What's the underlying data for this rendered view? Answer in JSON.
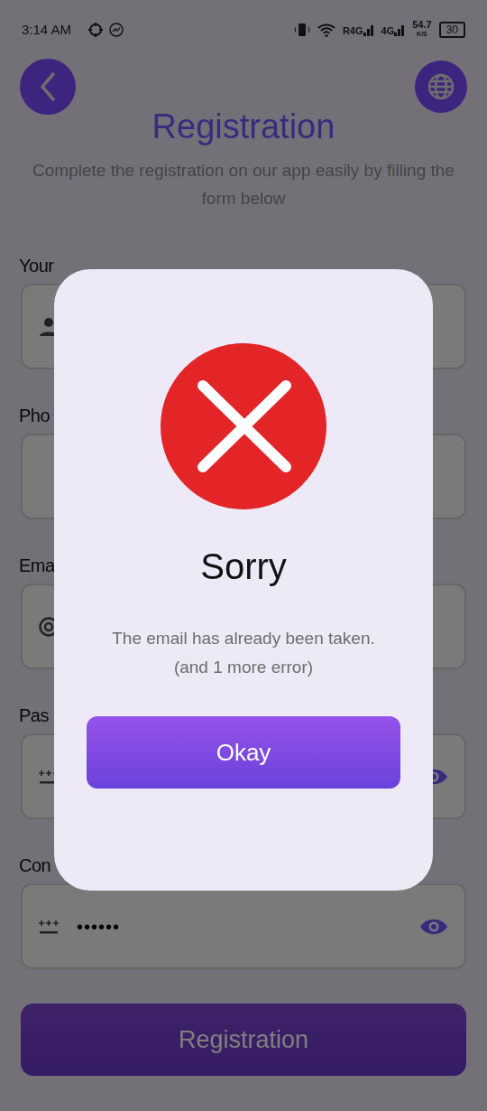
{
  "status_bar": {
    "time": "3:14 AM",
    "network_1": "R4G",
    "network_2": "4G",
    "speed": "54.7",
    "speed_unit": "K/S",
    "battery": "30"
  },
  "header": {
    "title": "Registration",
    "subtitle": "Complete the registration on our app easily by filling the form below"
  },
  "fields": [
    {
      "label": "Your",
      "kind": "name"
    },
    {
      "label": "Pho",
      "kind": "phone"
    },
    {
      "label": "Ema",
      "kind": "email"
    },
    {
      "label": "Pas",
      "kind": "password"
    },
    {
      "label": "Con",
      "kind": "password",
      "value": "••••••"
    }
  ],
  "submit_button": "Registration",
  "dialog": {
    "title": "Sorry",
    "message": "The email has already been taken.",
    "detail": "(and 1 more error)",
    "button": "Okay"
  }
}
